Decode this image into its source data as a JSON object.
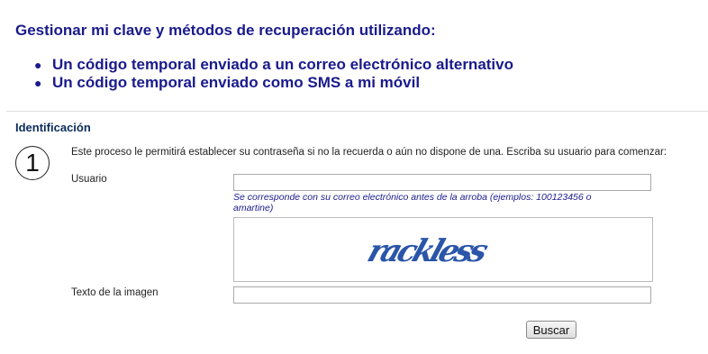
{
  "header": {
    "title": "Gestionar mi clave y métodos de recuperación utilizando:",
    "methods": [
      "Un código temporal enviado a un correo electrónico alternativo",
      "Un código temporal enviado como SMS a mi móvil"
    ]
  },
  "identification": {
    "section_title": "Identificación",
    "step_number": "1",
    "intro": "Este proceso le permitirá establecer su contraseña si no la recuerda o aún no dispone de una. Escriba su usuario para comenzar:",
    "username_label": "Usuario",
    "username_value": "",
    "username_hint": "Se corresponde con su correo electrónico antes de la arroba (ejemplos: 100123456 o amartine)",
    "captcha_text": "rackless",
    "image_text_label": "Texto de la imagen",
    "image_text_value": "",
    "search_button": "Buscar"
  },
  "colors": {
    "heading": "#1a1a8c",
    "captcha": "#2a55a8"
  }
}
